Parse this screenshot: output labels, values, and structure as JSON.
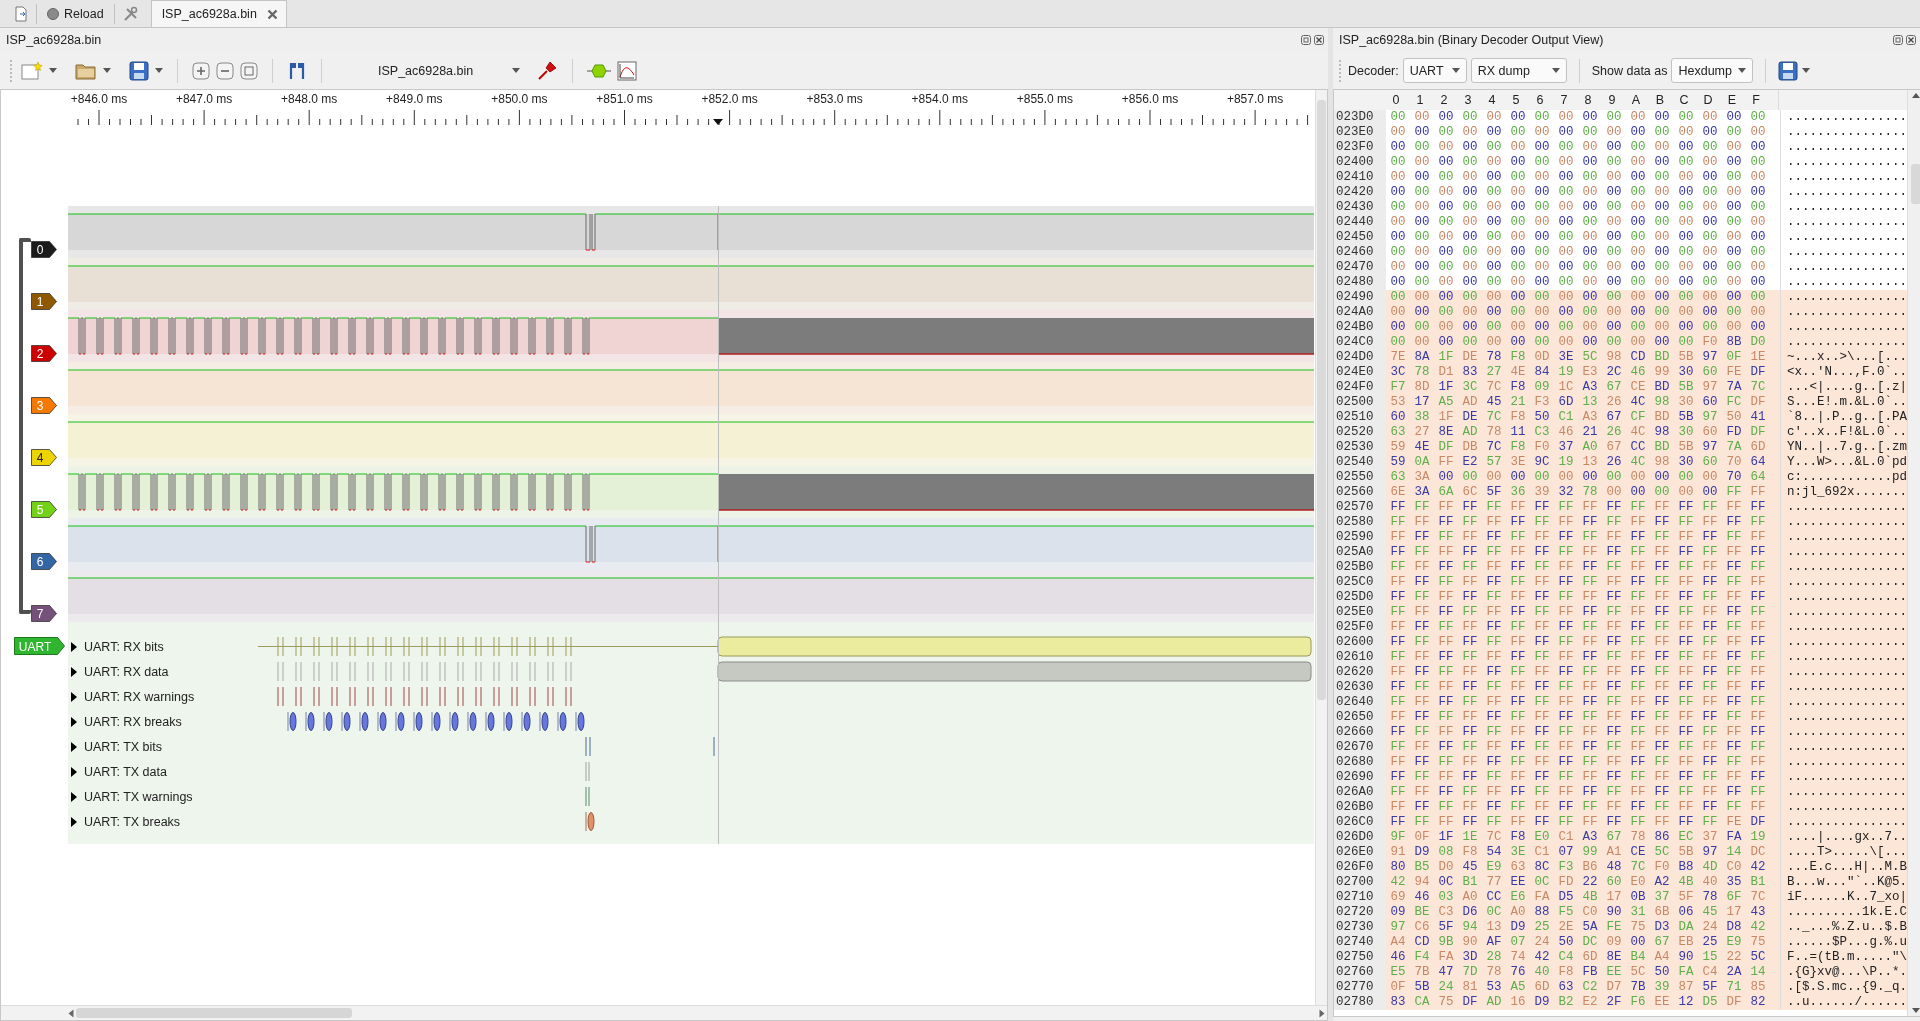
{
  "tab_bar": {
    "reload": "Reload",
    "tabs": [
      {
        "label": "ISP_ac6928a.bin",
        "selected": true
      }
    ]
  },
  "trace_view": {
    "title": "ISP_ac6928a.bin",
    "device": "ISP_ac6928a.bin",
    "ruler": [
      "+846.0 ms",
      "+847.0 ms",
      "+848.0 ms",
      "+849.0 ms",
      "+850.0 ms",
      "+851.0 ms",
      "+852.0 ms",
      "+853.0 ms",
      "+854.0 ms",
      "+855.0 ms",
      "+856.0 ms",
      "+857.0 ms"
    ],
    "channels": [
      {
        "label": "0",
        "color": "#1b1b1b",
        "kind": "glitch"
      },
      {
        "label": "1",
        "color": "#8f5902",
        "kind": "flat"
      },
      {
        "label": "2",
        "color": "#cc0000",
        "kind": "clock"
      },
      {
        "label": "3",
        "color": "#f57900",
        "kind": "flat"
      },
      {
        "label": "4",
        "color": "#edd400",
        "kind": "flat"
      },
      {
        "label": "5",
        "color": "#73d216",
        "kind": "clock"
      },
      {
        "label": "6",
        "color": "#3465a4",
        "kind": "glitch"
      },
      {
        "label": "7",
        "color": "#75507b",
        "kind": "flat"
      }
    ],
    "decoder": {
      "label": "UART",
      "rows": [
        {
          "label": "UART: RX bits",
          "expanded": false,
          "kind": "rxbits"
        },
        {
          "label": "UART: RX data",
          "expanded": false,
          "kind": "rxdata"
        },
        {
          "label": "UART: RX warnings",
          "expanded": false,
          "kind": "rxwarnings"
        },
        {
          "label": "UART: RX breaks",
          "expanded": false,
          "kind": "rxbreaks"
        },
        {
          "label": "UART: TX bits",
          "expanded": false,
          "kind": "txbits"
        },
        {
          "label": "UART: TX data",
          "expanded": false,
          "kind": "txdata"
        },
        {
          "label": "UART: TX warnings",
          "expanded": false,
          "kind": "txwarnings"
        },
        {
          "label": "UART: TX breaks",
          "expanded": false,
          "kind": "txbreaks"
        }
      ]
    }
  },
  "output_view": {
    "title": "ISP_ac6928a.bin (Binary Decoder Output View)",
    "decoder_label": "Decoder:",
    "decoder": "UART",
    "stream": "RX dump",
    "show_label": "Show data as",
    "format": "Hexdump",
    "columns": [
      "0",
      "1",
      "2",
      "3",
      "4",
      "5",
      "6",
      "7",
      "8",
      "9",
      "A",
      "B",
      "C",
      "D",
      "E",
      "F"
    ],
    "rows": [
      {
        "address": "023D0",
        "bytes": "00 00 00 00 00 00 00 00 00 00 00 00 00 00 00 00",
        "ascii": "................",
        "selected": false
      },
      {
        "address": "023E0",
        "bytes": "00 00 00 00 00 00 00 00 00 00 00 00 00 00 00 00",
        "ascii": "................",
        "selected": false
      },
      {
        "address": "023F0",
        "bytes": "00 00 00 00 00 00 00 00 00 00 00 00 00 00 00 00",
        "ascii": "................",
        "selected": false
      },
      {
        "address": "02400",
        "bytes": "00 00 00 00 00 00 00 00 00 00 00 00 00 00 00 00",
        "ascii": "................",
        "selected": false
      },
      {
        "address": "02410",
        "bytes": "00 00 00 00 00 00 00 00 00 00 00 00 00 00 00 00",
        "ascii": "................",
        "selected": false
      },
      {
        "address": "02420",
        "bytes": "00 00 00 00 00 00 00 00 00 00 00 00 00 00 00 00",
        "ascii": "................",
        "selected": false
      },
      {
        "address": "02430",
        "bytes": "00 00 00 00 00 00 00 00 00 00 00 00 00 00 00 00",
        "ascii": "................",
        "selected": false
      },
      {
        "address": "02440",
        "bytes": "00 00 00 00 00 00 00 00 00 00 00 00 00 00 00 00",
        "ascii": "................",
        "selected": false
      },
      {
        "address": "02450",
        "bytes": "00 00 00 00 00 00 00 00 00 00 00 00 00 00 00 00",
        "ascii": "................",
        "selected": false
      },
      {
        "address": "02460",
        "bytes": "00 00 00 00 00 00 00 00 00 00 00 00 00 00 00 00",
        "ascii": "................",
        "selected": false
      },
      {
        "address": "02470",
        "bytes": "00 00 00 00 00 00 00 00 00 00 00 00 00 00 00 00",
        "ascii": "................",
        "selected": false
      },
      {
        "address": "02480",
        "bytes": "00 00 00 00 00 00 00 00 00 00 00 00 00 00 00 00",
        "ascii": "................",
        "selected": false
      },
      {
        "address": "02490",
        "bytes": "00 00 00 00 00 00 00 00 00 00 00 00 00 00 00 00",
        "ascii": "................",
        "selected": true
      },
      {
        "address": "024A0",
        "bytes": "00 00 00 00 00 00 00 00 00 00 00 00 00 00 00 00",
        "ascii": "................",
        "selected": true
      },
      {
        "address": "024B0",
        "bytes": "00 00 00 00 00 00 00 00 00 00 00 00 00 00 00 00",
        "ascii": "................",
        "selected": true
      },
      {
        "address": "024C0",
        "bytes": "00 00 00 00 00 00 00 00 00 00 00 00 00 F0 8B D0",
        "ascii": "................",
        "selected": true
      },
      {
        "address": "024D0",
        "bytes": "7E 8A 1F DE 78 F8 0D 3E 5C 98 CD BD 5B 97 0F 1E",
        "ascii": "~...x..>\\...[...",
        "selected": true
      },
      {
        "address": "024E0",
        "bytes": "3C 78 D1 83 27 4E 84 19 E3 2C 46 99 30 60 FE DF",
        "ascii": "<x..'N...,F.0`..",
        "selected": true
      },
      {
        "address": "024F0",
        "bytes": "F7 8D 1F 3C 7C F8 09 1C A3 67 CE BD 5B 97 7A 7C",
        "ascii": "...<|....g..[.z|",
        "selected": true
      },
      {
        "address": "02500",
        "bytes": "53 17 A5 AD 45 21 F3 6D 13 26 4C 98 30 60 FC DF",
        "ascii": "S...E!.m.&L.0`..",
        "selected": true
      },
      {
        "address": "02510",
        "bytes": "60 38 1F DE 7C F8 50 C1 A3 67 CF BD 5B 97 50 41",
        "ascii": "`8..|.P..g..[.PA",
        "selected": true
      },
      {
        "address": "02520",
        "bytes": "63 27 8E AD 78 11 C3 46 21 26 4C 98 30 60 FD DF",
        "ascii": "c'..x..F!&L.0`..",
        "selected": true
      },
      {
        "address": "02530",
        "bytes": "59 4E DF DB 7C F8 F0 37 A0 67 CC BD 5B 97 7A 6D",
        "ascii": "YN..|..7.g..[.zm",
        "selected": true
      },
      {
        "address": "02540",
        "bytes": "59 0A FF E2 57 3E 9C 19 13 26 4C 98 30 60 70 64",
        "ascii": "Y...W>...&L.0`pd",
        "selected": true
      },
      {
        "address": "02550",
        "bytes": "63 3A 00 00 00 00 00 00 00 00 00 00 00 00 70 64",
        "ascii": "c:............pd",
        "selected": true
      },
      {
        "address": "02560",
        "bytes": "6E 3A 6A 6C 5F 36 39 32 78 00 00 00 00 00 FF FF",
        "ascii": "n:jl_692x.......",
        "selected": true
      },
      {
        "address": "02570",
        "bytes": "FF FF FF FF FF FF FF FF FF FF FF FF FF FF FF FF",
        "ascii": "................",
        "selected": true
      },
      {
        "address": "02580",
        "bytes": "FF FF FF FF FF FF FF FF FF FF FF FF FF FF FF FF",
        "ascii": "................",
        "selected": true
      },
      {
        "address": "02590",
        "bytes": "FF FF FF FF FF FF FF FF FF FF FF FF FF FF FF FF",
        "ascii": "................",
        "selected": true
      },
      {
        "address": "025A0",
        "bytes": "FF FF FF FF FF FF FF FF FF FF FF FF FF FF FF FF",
        "ascii": "................",
        "selected": true
      },
      {
        "address": "025B0",
        "bytes": "FF FF FF FF FF FF FF FF FF FF FF FF FF FF FF FF",
        "ascii": "................",
        "selected": true
      },
      {
        "address": "025C0",
        "bytes": "FF FF FF FF FF FF FF FF FF FF FF FF FF FF FF FF",
        "ascii": "................",
        "selected": true
      },
      {
        "address": "025D0",
        "bytes": "FF FF FF FF FF FF FF FF FF FF FF FF FF FF FF FF",
        "ascii": "................",
        "selected": true
      },
      {
        "address": "025E0",
        "bytes": "FF FF FF FF FF FF FF FF FF FF FF FF FF FF FF FF",
        "ascii": "................",
        "selected": true
      },
      {
        "address": "025F0",
        "bytes": "FF FF FF FF FF FF FF FF FF FF FF FF FF FF FF FF",
        "ascii": "................",
        "selected": true
      },
      {
        "address": "02600",
        "bytes": "FF FF FF FF FF FF FF FF FF FF FF FF FF FF FF FF",
        "ascii": "................",
        "selected": true
      },
      {
        "address": "02610",
        "bytes": "FF FF FF FF FF FF FF FF FF FF FF FF FF FF FF FF",
        "ascii": "................",
        "selected": true
      },
      {
        "address": "02620",
        "bytes": "FF FF FF FF FF FF FF FF FF FF FF FF FF FF FF FF",
        "ascii": "................",
        "selected": true
      },
      {
        "address": "02630",
        "bytes": "FF FF FF FF FF FF FF FF FF FF FF FF FF FF FF FF",
        "ascii": "................",
        "selected": true
      },
      {
        "address": "02640",
        "bytes": "FF FF FF FF FF FF FF FF FF FF FF FF FF FF FF FF",
        "ascii": "................",
        "selected": true
      },
      {
        "address": "02650",
        "bytes": "FF FF FF FF FF FF FF FF FF FF FF FF FF FF FF FF",
        "ascii": "................",
        "selected": true
      },
      {
        "address": "02660",
        "bytes": "FF FF FF FF FF FF FF FF FF FF FF FF FF FF FF FF",
        "ascii": "................",
        "selected": true
      },
      {
        "address": "02670",
        "bytes": "FF FF FF FF FF FF FF FF FF FF FF FF FF FF FF FF",
        "ascii": "................",
        "selected": true
      },
      {
        "address": "02680",
        "bytes": "FF FF FF FF FF FF FF FF FF FF FF FF FF FF FF FF",
        "ascii": "................",
        "selected": true
      },
      {
        "address": "02690",
        "bytes": "FF FF FF FF FF FF FF FF FF FF FF FF FF FF FF FF",
        "ascii": "................",
        "selected": true
      },
      {
        "address": "026A0",
        "bytes": "FF FF FF FF FF FF FF FF FF FF FF FF FF FF FF FF",
        "ascii": "................",
        "selected": true
      },
      {
        "address": "026B0",
        "bytes": "FF FF FF FF FF FF FF FF FF FF FF FF FF FF FF FF",
        "ascii": "................",
        "selected": true
      },
      {
        "address": "026C0",
        "bytes": "FF FF FF FF FF FF FF FF FF FF FF FF FF FF FE DF",
        "ascii": "................",
        "selected": true
      },
      {
        "address": "026D0",
        "bytes": "9F 0F 1F 1E 7C F8 E0 C1 A3 67 78 86 EC 37 FA 19",
        "ascii": "....|....gx..7..",
        "selected": true
      },
      {
        "address": "026E0",
        "bytes": "91 D9 08 F8 54 3E C1 07 99 A1 CE 5C 5B 97 14 DC",
        "ascii": "....T>.....\\[...",
        "selected": true
      },
      {
        "address": "026F0",
        "bytes": "80 B5 D0 45 E9 63 8C F3 B6 48 7C F0 B8 4D C0 42",
        "ascii": "...E.c...H|..M.B",
        "selected": true
      },
      {
        "address": "02700",
        "bytes": "42 94 0C B1 77 EE 0C FD 22 60 E0 A2 4B 40 35 B1",
        "ascii": "B...w...\"`..K@5.",
        "selected": true
      },
      {
        "address": "02710",
        "bytes": "69 46 03 A0 CC E6 FA D5 4B 17 0B 37 5F 78 6F 7C",
        "ascii": "iF......K..7_xo|",
        "selected": true
      },
      {
        "address": "02720",
        "bytes": "09 BE C3 D6 0C A0 88 F5 C0 90 31 6B 06 45 17 43",
        "ascii": "..........1k.E.C",
        "selected": true
      },
      {
        "address": "02730",
        "bytes": "97 C6 5F 94 13 D9 25 2E 5A FE 75 D3 DA 24 D8 42",
        "ascii": ".._...%.Z.u..$.B",
        "selected": true
      },
      {
        "address": "02740",
        "bytes": "A4 CD 9B 90 AF 07 24 50 DC 09 00 67 EB 25 E9 75",
        "ascii": "......$P...g.%.u",
        "selected": true
      },
      {
        "address": "02750",
        "bytes": "46 F4 FA 3D 28 74 42 C4 6D 8E B4 A4 90 15 22 5C",
        "ascii": "F..=(tB.m.....\"\\",
        "selected": true
      },
      {
        "address": "02760",
        "bytes": "E5 7B 47 7D 78 76 40 F8 FB EE 5C 50 FA C4 2A 14",
        "ascii": ".{G}xv@...\\P..*.",
        "selected": true
      },
      {
        "address": "02770",
        "bytes": "0F 5B 24 81 53 A5 6D 63 C2 D7 7B 39 87 5F 71 85",
        "ascii": ".[$.S.mc..{9._q.",
        "selected": true
      },
      {
        "address": "02780",
        "bytes": "83 CA 75 DF AD 16 D9 B2 E2 2F F6 EE 12 D5 DF 82",
        "ascii": "..u....../......",
        "selected": true
      }
    ]
  }
}
